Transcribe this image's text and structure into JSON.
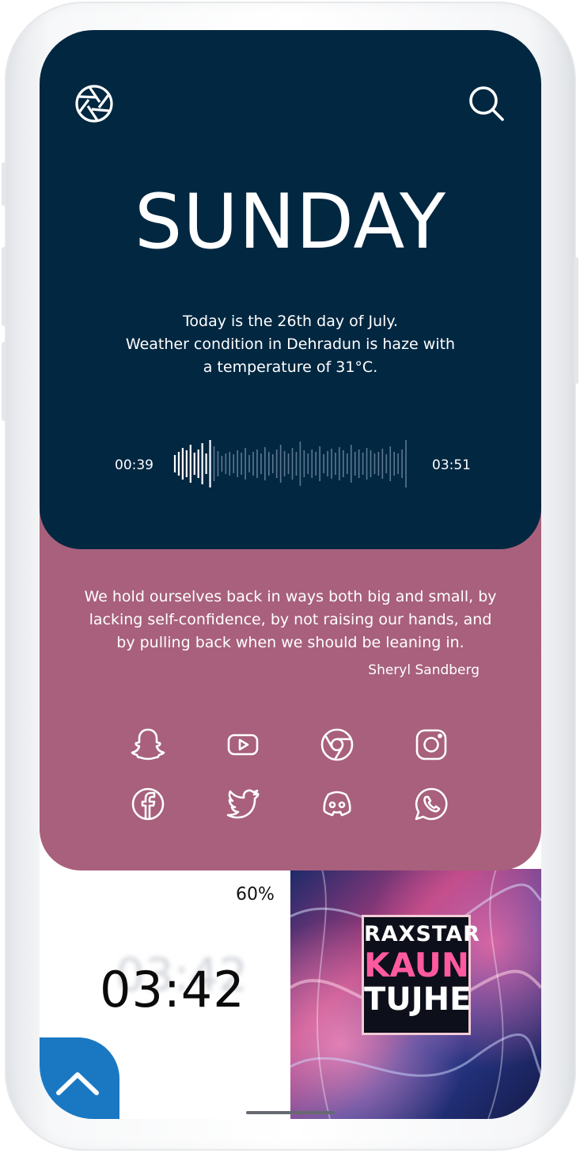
{
  "header": {
    "left_icon": "aperture-icon",
    "right_icon": "search-icon"
  },
  "day": "SUNDAY",
  "info_lines": [
    "Today is the 26th day of July.",
    "Weather condition in Dehradun is haze with",
    "a temperature of 31°C."
  ],
  "player": {
    "elapsed": "00:39",
    "total": "03:51",
    "progress": 0.17
  },
  "quote": {
    "lines": [
      "We hold ourselves back in ways both big and small, by",
      "lacking self-confidence, by not raising our hands, and",
      "by pulling back when we should be leaning in."
    ],
    "author": "Sheryl Sandberg"
  },
  "apps": [
    "snapchat-icon",
    "youtube-icon",
    "chrome-icon",
    "instagram-icon",
    "facebook-icon",
    "twitter-icon",
    "discord-icon",
    "whatsapp-icon"
  ],
  "battery": "60%",
  "clock": {
    "time": "03:42",
    "ghost": "03:42"
  },
  "album": {
    "artist": "RAXSTAR",
    "title_line1": "KAUN",
    "title_line2": "TUJHE"
  },
  "colors": {
    "top_panel": "#022741",
    "quote_panel": "#a8607c",
    "up_button": "#1a78c2"
  },
  "up_button_icon": "chevron-up-icon"
}
